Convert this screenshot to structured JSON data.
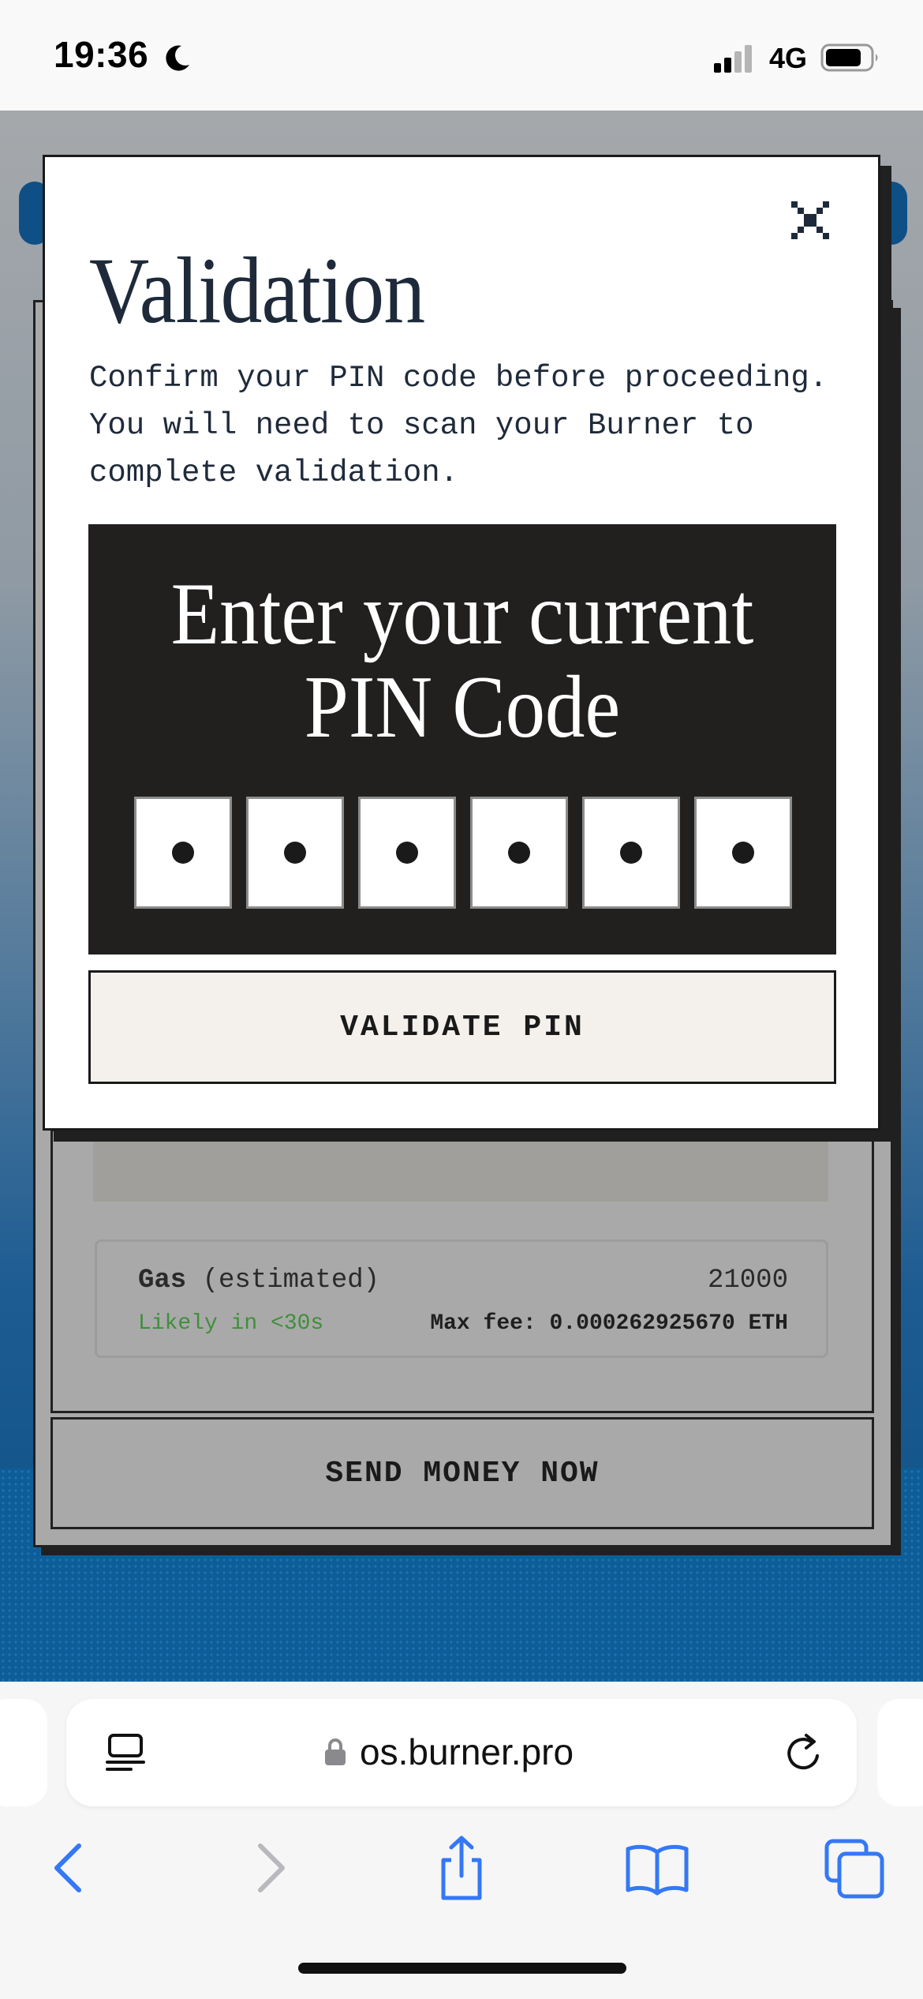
{
  "status_bar": {
    "time": "19:36",
    "network": "4G"
  },
  "background_form": {
    "gas_label_bold": "Gas",
    "gas_label_rest": " (estimated)",
    "gas_value": "21000",
    "likely_text": "Likely in <30s",
    "max_fee": "Max fee: 0.000262925670 ETH",
    "send_button": "SEND MONEY NOW"
  },
  "modal": {
    "title": "Validation",
    "description": "Confirm your PIN code before proceeding. You will need to scan your Burner to complete validation.",
    "pin_heading_line1": "Enter your current",
    "pin_heading_line2": "PIN Code",
    "pin_digits": [
      "•",
      "•",
      "•",
      "•",
      "•",
      "•"
    ],
    "validate_button": "VALIDATE PIN"
  },
  "browser": {
    "url": "os.burner.pro"
  },
  "colors": {
    "title": "#1e2a3a",
    "pin_panel": "#221f1f",
    "validate_bg": "#f4f1ec",
    "link_blue": "#3478f6",
    "likely_green": "#3f8f3a"
  }
}
